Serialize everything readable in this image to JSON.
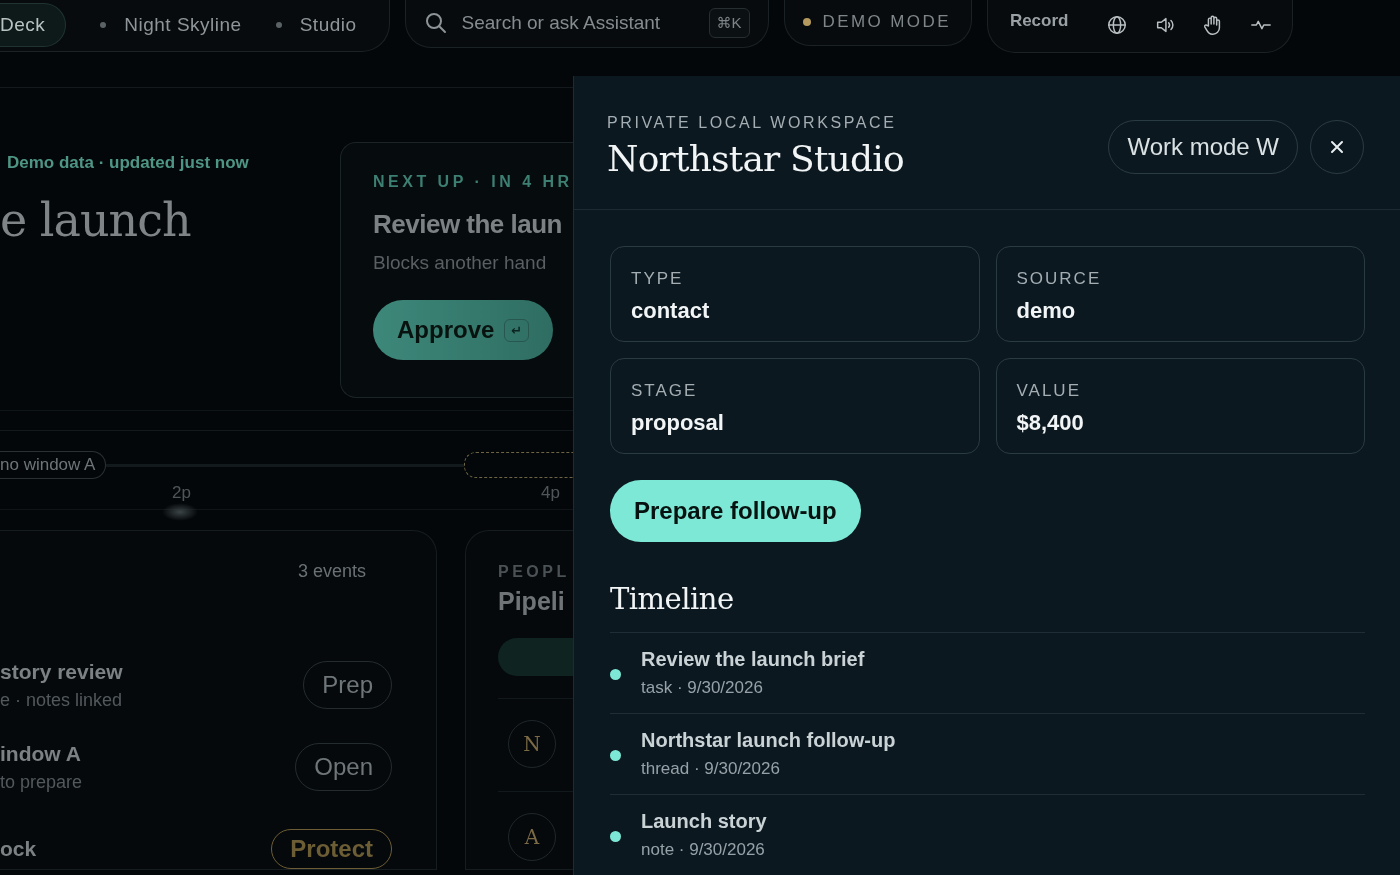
{
  "top_bar": {
    "workspaces": [
      {
        "label": "Deck",
        "selected": true
      },
      {
        "label": "Night Skyline",
        "selected": false
      },
      {
        "label": "Studio",
        "selected": false
      }
    ],
    "search": {
      "placeholder": "Search or ask Assistant",
      "shortcut": "⌘K"
    },
    "mode_badge": "DEMO MODE",
    "record": "Record"
  },
  "overview": {
    "status": "Demo data · updated just now",
    "headline": "e launch"
  },
  "next_up": {
    "eyebrow": "NEXT UP · IN 4 HR",
    "title": "Review the laun",
    "subtitle": "Blocks another hand",
    "action": "Approve",
    "action_key": "↵"
  },
  "day_timeline": {
    "chip": "no window A",
    "ticks": [
      "2p",
      "4p"
    ]
  },
  "agenda": {
    "count": "3 events",
    "events": [
      {
        "title": "story review",
        "meta": "e · notes linked",
        "action": "Prep",
        "kind": "plain"
      },
      {
        "title": "indow A",
        "meta": "to prepare",
        "action": "Open",
        "kind": "plain"
      },
      {
        "title": "ock",
        "action": "Protect",
        "kind": "warning"
      }
    ]
  },
  "pipeline": {
    "eyebrow": "PEOPL",
    "title": "Pipeli",
    "contacts": [
      {
        "initial": "N"
      },
      {
        "initial": "A"
      }
    ]
  },
  "detail_panel": {
    "eyebrow": "PRIVATE LOCAL WORKSPACE",
    "title": "Northstar Studio",
    "mode_button": "Work mode W",
    "fields": [
      {
        "label": "TYPE",
        "value": "contact"
      },
      {
        "label": "SOURCE",
        "value": "demo"
      },
      {
        "label": "STAGE",
        "value": "proposal"
      },
      {
        "label": "VALUE",
        "value": "$8,400"
      }
    ],
    "action": "Prepare follow-up",
    "timeline_title": "Timeline",
    "timeline": [
      {
        "title": "Review the launch brief",
        "meta": "task · 9/30/2026"
      },
      {
        "title": "Northstar launch follow-up",
        "meta": "thread · 9/30/2026"
      },
      {
        "title": "Launch story",
        "meta": "note · 9/30/2026"
      }
    ]
  }
}
